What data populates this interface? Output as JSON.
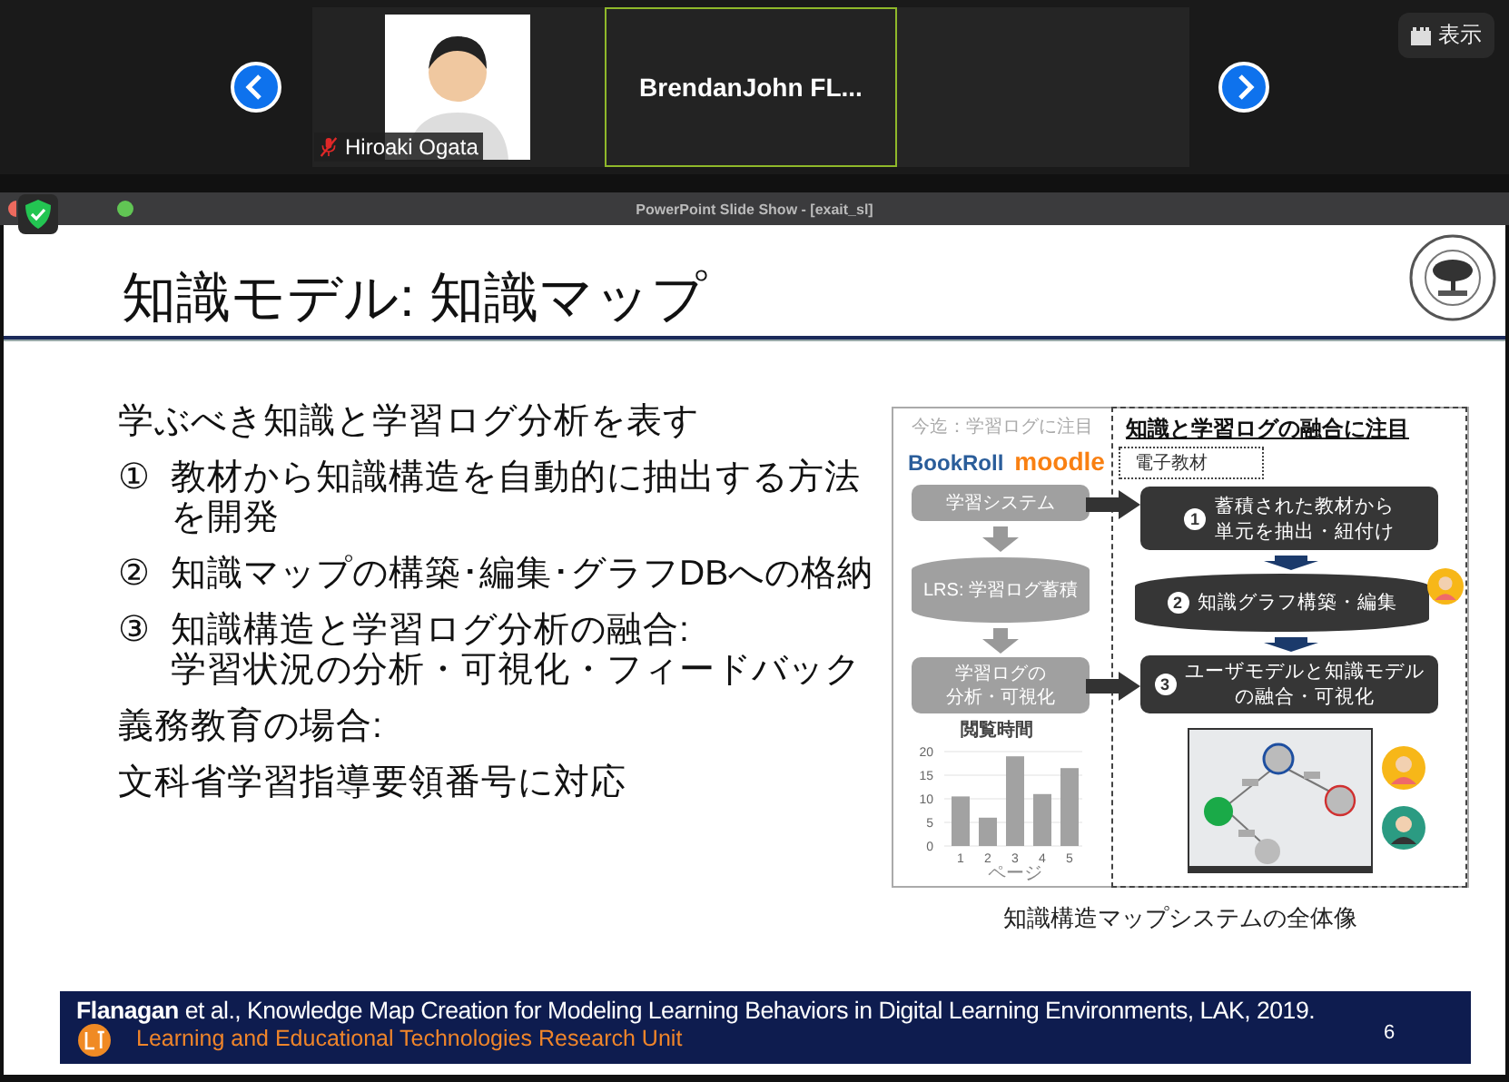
{
  "meeting": {
    "participants": [
      {
        "kind": "avatar",
        "name": "Hiroaki Ogata",
        "muted": true,
        "selected": false
      },
      {
        "kind": "name",
        "name": "BrendanJohn  FL...",
        "muted": false,
        "selected": true
      },
      {
        "kind": "empty",
        "selected": false
      }
    ],
    "view_button": "表示"
  },
  "window": {
    "title": "PowerPoint Slide Show - [exait_sl]"
  },
  "slide": {
    "title": "知識モデル: 知識マップ",
    "bullets": [
      {
        "kind": "plain",
        "lines": [
          "学ぶべき知識と学習ログ分析を表す"
        ]
      },
      {
        "kind": "numbered",
        "marker": "①",
        "lines": [
          "教材から知識構造を自動的に抽出する方法",
          "を開発"
        ]
      },
      {
        "kind": "numbered",
        "marker": "②",
        "lines": [
          "知識マップの構築･編集･グラフDBへの格納"
        ]
      },
      {
        "kind": "numbered",
        "marker": "③",
        "lines": [
          "知識構造と学習ログ分析の融合:",
          "学習状況の分析・可視化・フィードバック"
        ]
      },
      {
        "kind": "plain",
        "lines": [
          "義務教育の場合:"
        ]
      },
      {
        "kind": "plain",
        "lines": [
          "文科省学習指導要領番号に対応"
        ]
      }
    ],
    "diagram": {
      "left_heading": "今迄：学習ログに注目",
      "right_heading": "知識と学習ログの融合に注目",
      "logos": [
        "BookRoll",
        "moodle"
      ],
      "left_steps": [
        {
          "kind": "box",
          "lines": [
            "学習システム"
          ]
        },
        {
          "kind": "cylinder",
          "lines": [
            "LRS: 学習ログ蓄積"
          ]
        },
        {
          "kind": "box",
          "lines": [
            "学習ログの",
            "分析・可視化"
          ]
        }
      ],
      "material_label": "電子教材",
      "right_steps": [
        {
          "kind": "box",
          "number": "1",
          "lines": [
            "蓄積された教材から",
            "単元を抽出・紐付け"
          ]
        },
        {
          "kind": "cylinder",
          "number": "2",
          "lines": [
            "知識グラフ構築・編集"
          ]
        },
        {
          "kind": "box",
          "number": "3",
          "lines": [
            "ユーザモデルと知識モデル",
            "の融合・可視化"
          ]
        }
      ],
      "chart_data": {
        "type": "bar",
        "grid": true,
        "title": "閲覧時間",
        "xlabel": "ページ",
        "categories": [
          "1",
          "2",
          "3",
          "4",
          "5"
        ],
        "values": [
          10.5,
          6,
          19,
          11,
          16.5
        ],
        "ylim": [
          0,
          20
        ],
        "yticks": [
          0,
          5,
          10,
          15,
          20
        ]
      }
    },
    "caption": "知識構造マップシステムの全体像",
    "citation": "**Flanagan** et al., Knowledge Map Creation for Modeling Learning Behaviors in Digital Learning Environments, LAK, 2019.",
    "unit": "Learning and Educational Technologies Research Unit",
    "page": "6"
  }
}
